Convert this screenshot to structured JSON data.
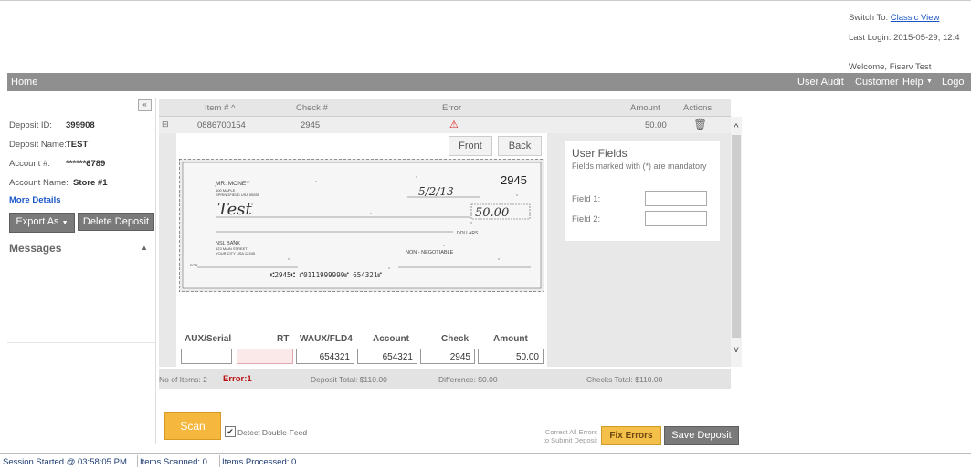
{
  "header": {
    "switch_label": "Switch To:",
    "switch_link": "Classic View",
    "last_login": "Last Login: 2015-05-29, 12:4",
    "welcome": "Welcome, Fiserv Test"
  },
  "nav": {
    "home": "Home",
    "items": [
      "User Audit",
      "Customer",
      "Help",
      "Logo"
    ]
  },
  "deposit": {
    "id_label": "Deposit ID:",
    "id_value": "399908",
    "name_label": "Deposit Name:",
    "name_value": "TEST",
    "account_label": "Account #:",
    "account_value": "******6789",
    "account_name_label": "Account Name:",
    "account_name_value": "Store #1",
    "more_details": "More Details",
    "export_label": "Export As",
    "delete_label": "Delete Deposit",
    "messages_label": "Messages"
  },
  "grid": {
    "columns": [
      "Item # ^",
      "Check #",
      "Error",
      "Amount",
      "Actions"
    ],
    "rows": [
      {
        "item": "0886700154",
        "check": "2945",
        "amount": "50.00"
      }
    ]
  },
  "detail": {
    "front_label": "Front",
    "back_label": "Back",
    "user_fields_title": "User Fields",
    "user_fields_note": "Fields marked with (*) are mandatory",
    "field1_label": "Field 1:",
    "field2_label": "Field 2:"
  },
  "check_image": {
    "payer": "MR. MONEY",
    "payer_addr1": "100 MAPLE",
    "payer_addr2": "SPRINGFIELD USA 55555",
    "number": "2945",
    "date": "5/2/13",
    "payee": "Test",
    "amount": "50.00",
    "dollars": "DOLLARS",
    "bank": "NSL BANK",
    "bank_addr1": "123 MAIN STREET",
    "bank_addr2": "YOUR CITY USA 12345",
    "nonneg": "NON - NEGOTIABLE",
    "memo": "FOR",
    "micr": "⑆2945⑆ ⑈0111999999⑈ 654321⑈"
  },
  "micr_fields": {
    "labels": [
      "AUX/Serial",
      "RT",
      "WAUX/FLD4",
      "Account",
      "Check",
      "Amount"
    ],
    "values": [
      "",
      "",
      "654321",
      "654321",
      "2945",
      "50.00"
    ]
  },
  "summary": {
    "items": "No of Items: 2",
    "error": "Error:1",
    "deposit_total": "Deposit Total: $110.00",
    "difference": "Difference: $0.00",
    "checks_total": "Checks Total: $110.00"
  },
  "footer": {
    "scan_label": "Scan",
    "detect_label": "Detect Double-Feed",
    "correct_note_1": "Correct All Errors",
    "correct_note_2": "to Submit Deposit",
    "fix_label": "Fix Errors",
    "save_label": "Save Deposit"
  },
  "status": {
    "session": "Session Started @ 03:58:05 PM",
    "scanned": "Items Scanned: 0",
    "processed": "Items Processed: 0"
  }
}
